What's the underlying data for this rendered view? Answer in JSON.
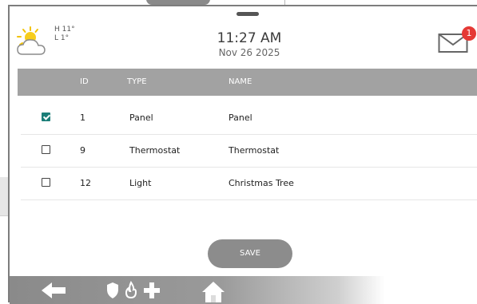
{
  "weather": {
    "icon": "partly-sunny-icon",
    "high": "H 11°",
    "low": "L 1°"
  },
  "clock": {
    "time": "11:27 AM",
    "date": "Nov 26 2025"
  },
  "messages": {
    "icon": "mail-icon",
    "badge": "1"
  },
  "table": {
    "headers": {
      "id": "ID",
      "type": "TYPE",
      "name": "NAME"
    },
    "rows": [
      {
        "checked": true,
        "id": "1",
        "type": "Panel",
        "name": "Panel"
      },
      {
        "checked": false,
        "id": "9",
        "type": "Thermostat",
        "name": "Thermostat"
      },
      {
        "checked": false,
        "id": "12",
        "type": "Light",
        "name": "Christmas Tree"
      }
    ]
  },
  "actions": {
    "save": "SAVE"
  },
  "bottom_nav": {
    "icons": [
      "back-arrow-icon",
      "shield-icon",
      "fire-icon",
      "medical-plus-icon",
      "home-icon"
    ]
  },
  "colors": {
    "header": "#a2a2a2",
    "checkbox_checked": "#1b7e78",
    "badge": "#e53935",
    "save_button": "#8c8c8c"
  }
}
